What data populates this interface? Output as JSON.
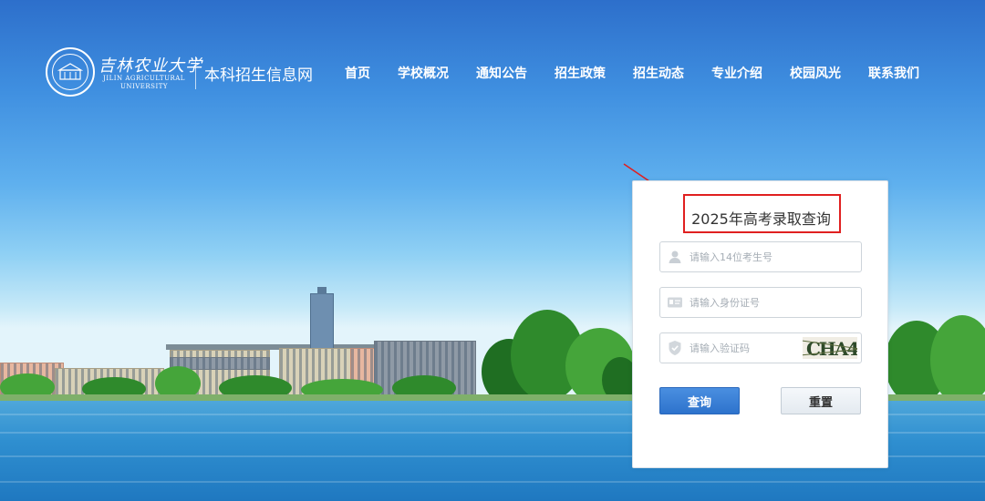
{
  "header": {
    "university_cn": "吉林农业大学",
    "university_en_line1": "JILIN AGRICULTURAL",
    "university_en_line2": "UNIVERSITY",
    "site_name": "本科招生信息网"
  },
  "nav": {
    "items": [
      {
        "label": "首页"
      },
      {
        "label": "学校概况"
      },
      {
        "label": "通知公告"
      },
      {
        "label": "招生政策"
      },
      {
        "label": "招生动态"
      },
      {
        "label": "专业介绍"
      },
      {
        "label": "校园风光"
      },
      {
        "label": "联系我们"
      }
    ]
  },
  "query_panel": {
    "title": "2025年高考录取查询",
    "exam_number": {
      "placeholder": "请输入14位考生号",
      "value": ""
    },
    "id_number": {
      "placeholder": "请输入身份证号",
      "value": ""
    },
    "captcha": {
      "placeholder": "请输入验证码",
      "value": "",
      "image_text": "CHA4"
    },
    "query_label": "查询",
    "reset_label": "重置"
  },
  "colors": {
    "highlight": "#e02020",
    "query_button": "#2d73cc",
    "sky_top": "#2d6fcb"
  }
}
